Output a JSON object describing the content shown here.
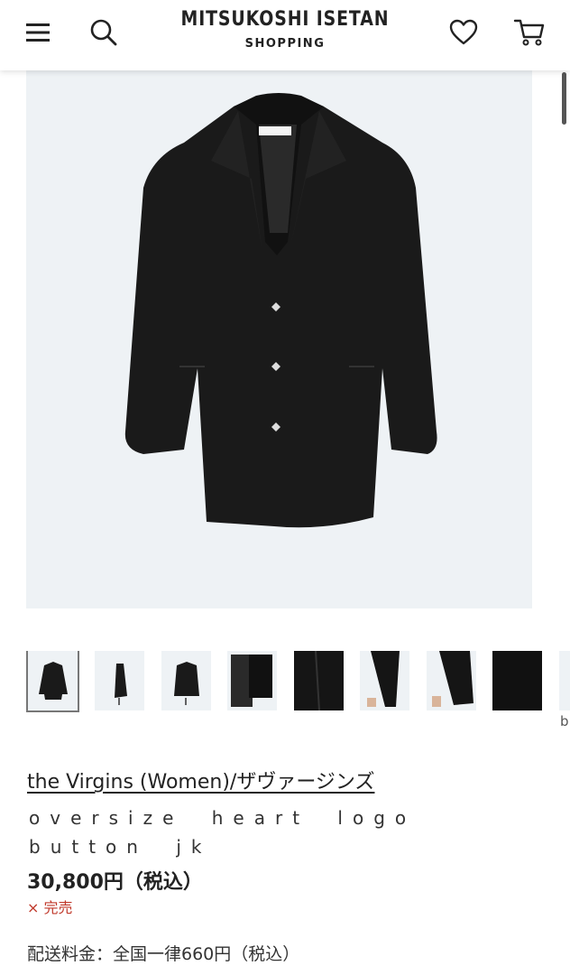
{
  "header": {
    "brand_title": "MITSUKOSHI ISETAN",
    "brand_subtitle": "SHOPPING",
    "icons": [
      "menu-icon",
      "search-icon",
      "heart-icon",
      "cart-icon"
    ]
  },
  "product": {
    "brand": "the Virgins (Women)/ザヴァージンズ",
    "name": "oversize heart logo button jk",
    "price": "30,800円（税込）",
    "soldout_mark": "×",
    "soldout_text": "完売",
    "shipping": "配送料金：全国一律660円（税込）"
  },
  "gallery": {
    "thumbnail_count_visible": 8,
    "selected_index": 0,
    "overflow_hint": "b"
  },
  "colors": {
    "image_bg": "#eef2f5",
    "soldout": "#c0392b",
    "text": "#222222"
  }
}
